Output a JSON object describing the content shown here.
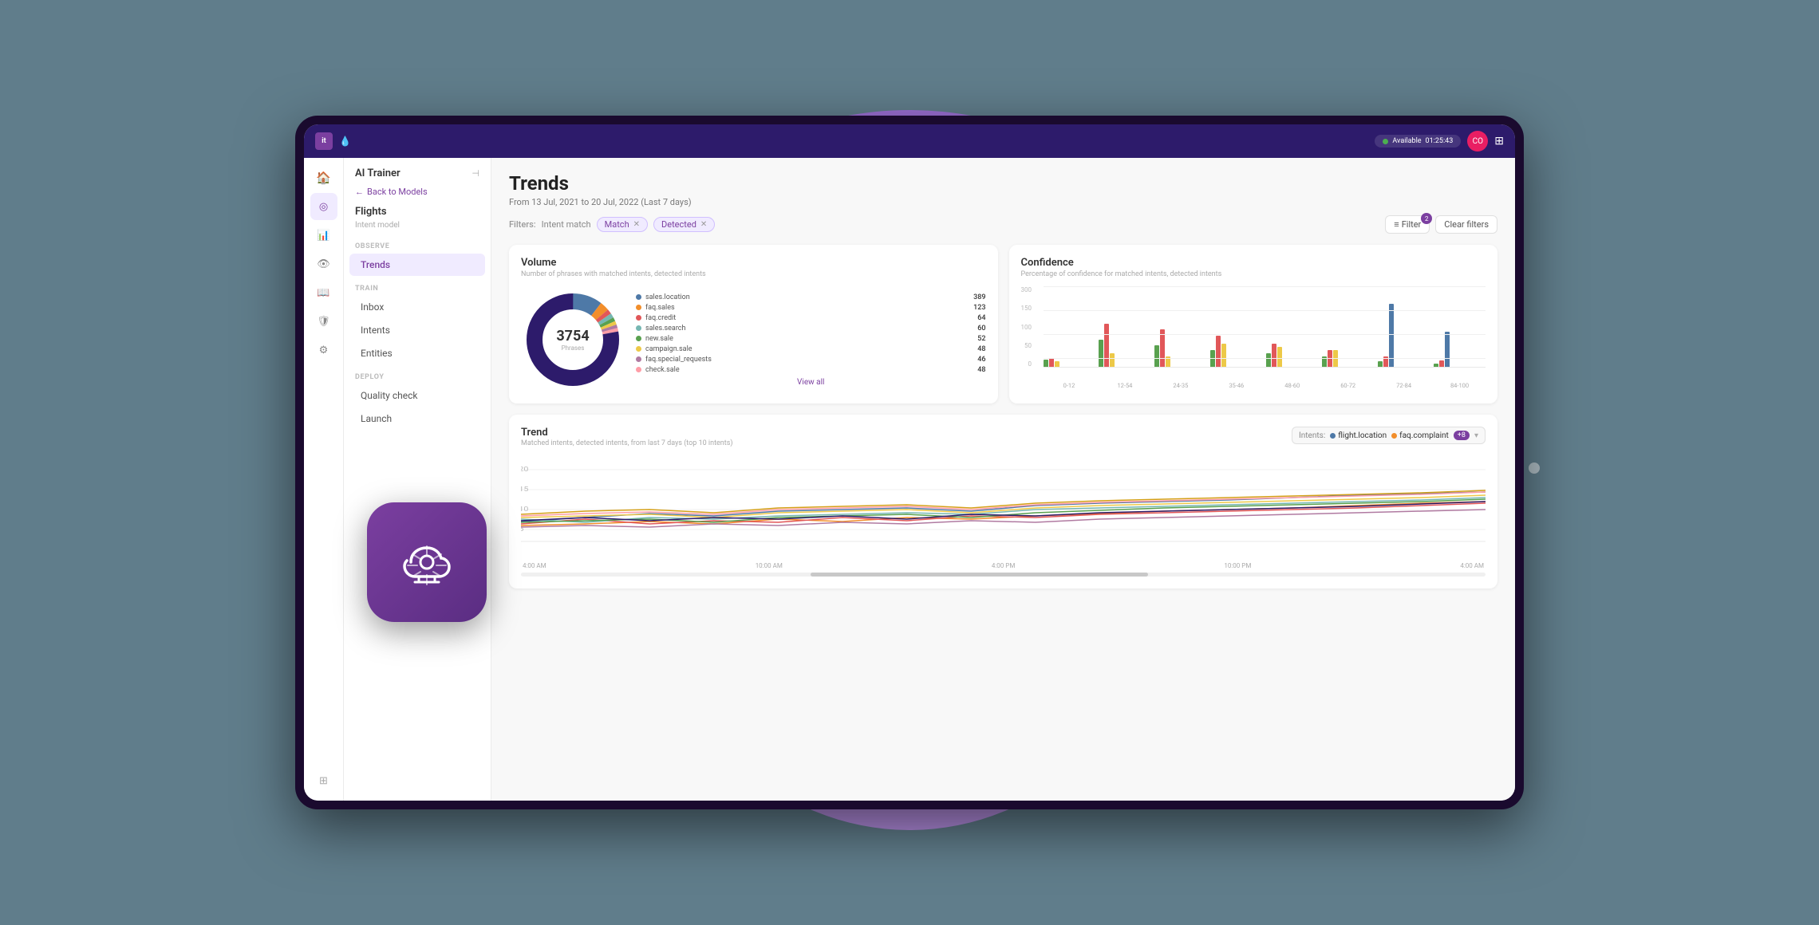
{
  "background": {
    "color": "#5a7a8a"
  },
  "topbar": {
    "logo": "it",
    "status_label": "Available",
    "status_time": "01:25:43",
    "avatar_initials": "CO",
    "avatar_color": "#e91e63"
  },
  "sidebar": {
    "icons": [
      {
        "name": "home-icon",
        "glyph": "⌂",
        "active": false
      },
      {
        "name": "brain-icon",
        "glyph": "◎",
        "active": true
      },
      {
        "name": "chart-icon",
        "glyph": "↑",
        "active": false
      },
      {
        "name": "eye-icon",
        "glyph": "◉",
        "active": false
      },
      {
        "name": "book-icon",
        "glyph": "☰",
        "active": false
      },
      {
        "name": "shield-icon",
        "glyph": "⬡",
        "active": false
      },
      {
        "name": "gear-icon",
        "glyph": "⚙",
        "active": false
      }
    ],
    "bottom_icon": "⊞"
  },
  "nav_panel": {
    "title": "AI Trainer",
    "back_label": "Back to Models",
    "model_name": "Flights",
    "model_type": "Intent model",
    "observe_label": "OBSERVE",
    "observe_items": [
      {
        "label": "Trends",
        "active": true
      }
    ],
    "train_label": "TRAIN",
    "train_items": [
      {
        "label": "Inbox",
        "active": false
      },
      {
        "label": "Intents",
        "active": false
      },
      {
        "label": "Entities",
        "active": false
      }
    ],
    "deploy_label": "DEPLOY",
    "deploy_items": [
      {
        "label": "Quality check",
        "active": false
      },
      {
        "label": "Launch",
        "active": false
      }
    ]
  },
  "content": {
    "page_title": "Trends",
    "date_range": "From 13 Jul, 2021 to 20 Jul, 2022 (Last 7 days)",
    "filters_label": "Filters:",
    "filter_chips": [
      {
        "label": "Intent match"
      },
      {
        "label": "Match"
      },
      {
        "label": "Detected"
      }
    ],
    "filter_button": "Filter",
    "filter_count": "2",
    "clear_filters": "Clear filters",
    "volume_card": {
      "title": "Volume",
      "subtitle": "Number of phrases with matched intents, detected intents",
      "total_number": "3754",
      "total_label": "Phrases",
      "legend": [
        {
          "label": "sales.location",
          "value": "389",
          "color": "#4e79a7"
        },
        {
          "label": "faq.sales",
          "value": "123",
          "color": "#f28e2b"
        },
        {
          "label": "faq.credit",
          "value": "64",
          "color": "#e15759"
        },
        {
          "label": "sales.search",
          "value": "60",
          "color": "#76b7b2"
        },
        {
          "label": "new.sale",
          "value": "52",
          "color": "#59a14f"
        },
        {
          "label": "campaign.sale",
          "value": "48",
          "color": "#edc948"
        },
        {
          "label": "faq.special_requests",
          "value": "46",
          "color": "#b07aa1"
        },
        {
          "label": "check.sale",
          "value": "48",
          "color": "#ff9da7"
        }
      ],
      "view_all": "View all"
    },
    "confidence_card": {
      "title": "Confidence",
      "subtitle": "Percentage of confidence for matched intents, detected intents",
      "y_labels": [
        "300",
        "150",
        "100",
        "50"
      ],
      "x_labels": [
        "0-12",
        "12-54",
        "24-35",
        "35-46",
        "48-60",
        "60-72",
        "72-84",
        "84-100"
      ],
      "bars": [
        {
          "heights": [
            10,
            12,
            8
          ],
          "colors": [
            "#59a14f",
            "#e15759",
            "#edc948"
          ]
        },
        {
          "heights": [
            40,
            60,
            20
          ],
          "colors": [
            "#59a14f",
            "#e15759",
            "#edc948"
          ]
        },
        {
          "heights": [
            35,
            55,
            15
          ],
          "colors": [
            "#59a14f",
            "#e15759",
            "#edc948"
          ]
        },
        {
          "heights": [
            25,
            45,
            10
          ],
          "colors": [
            "#59a14f",
            "#e15759",
            "#edc948"
          ]
        },
        {
          "heights": [
            20,
            35,
            30
          ],
          "colors": [
            "#59a14f",
            "#e15759",
            "#edc948"
          ]
        },
        {
          "heights": [
            15,
            25,
            25
          ],
          "colors": [
            "#59a14f",
            "#e15759",
            "#edc948"
          ]
        },
        {
          "heights": [
            8,
            15,
            90
          ],
          "colors": [
            "#59a14f",
            "#e15759",
            "#4e79a7"
          ]
        },
        {
          "heights": [
            5,
            10,
            50
          ],
          "colors": [
            "#59a14f",
            "#e15759",
            "#4e79a7"
          ]
        }
      ]
    },
    "trend_card": {
      "title": "Trend",
      "subtitle": "Matched intents, detected intents, from last 7 days (top 10 intents)",
      "intents_label": "Intents:",
      "intent_chips": [
        {
          "label": "flight.location",
          "color": "#4e79a7"
        },
        {
          "label": "faq.complaint",
          "color": "#f28e2b"
        }
      ],
      "intent_plus": "+8",
      "x_labels": [
        "4:00 AM",
        "10:00 AM",
        "4:00 PM",
        "10:00 PM",
        "4:00 AM"
      ]
    }
  }
}
